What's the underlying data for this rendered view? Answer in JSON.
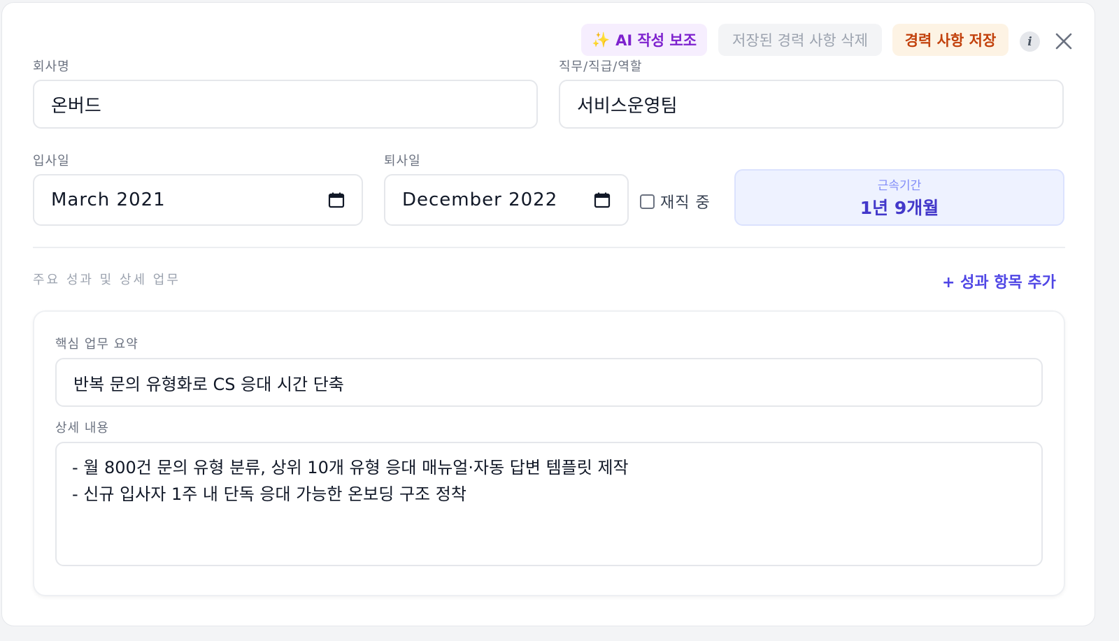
{
  "toolbar": {
    "ai_label": "AI 작성 보조",
    "ai_icon": "sparkles-icon",
    "delete_label": "저장된 경력 사항 삭제",
    "save_label": "경력 사항 저장",
    "info_label": "i"
  },
  "company": {
    "label": "회사명",
    "value": "온버드"
  },
  "role": {
    "label": "직무/직급/역할",
    "value": "서비스운영팀"
  },
  "start_date": {
    "label": "입사일",
    "value": "March 2021"
  },
  "end_date": {
    "label": "퇴사일",
    "value": "December 2022"
  },
  "currently_employed": {
    "label": "재직 중",
    "checked": false
  },
  "tenure": {
    "label": "근속기간",
    "value": "1년 9개월"
  },
  "achievements": {
    "section_label": "주요 성과 및 상세 업무",
    "add_label": "+ 성과 항목 추가",
    "items": [
      {
        "summary_label": "핵심 업무 요약",
        "summary_value": "반복 문의 유형화로 CS 응대 시간 단축",
        "detail_label": "상세 내용",
        "detail_lines": [
          "- 월 800건 문의 유형 분류, 상위 10개 유형 응대 매뉴얼·자동 답변 템플릿 제작",
          "- 신규 입사자 1주 내 단독 응대 가능한 온보딩 구조 정착"
        ]
      }
    ]
  },
  "colors": {
    "accent": "#4f46e5",
    "ai": "#7e22ce",
    "save": "#c2410c",
    "tenure_bg": "#eef2ff"
  }
}
